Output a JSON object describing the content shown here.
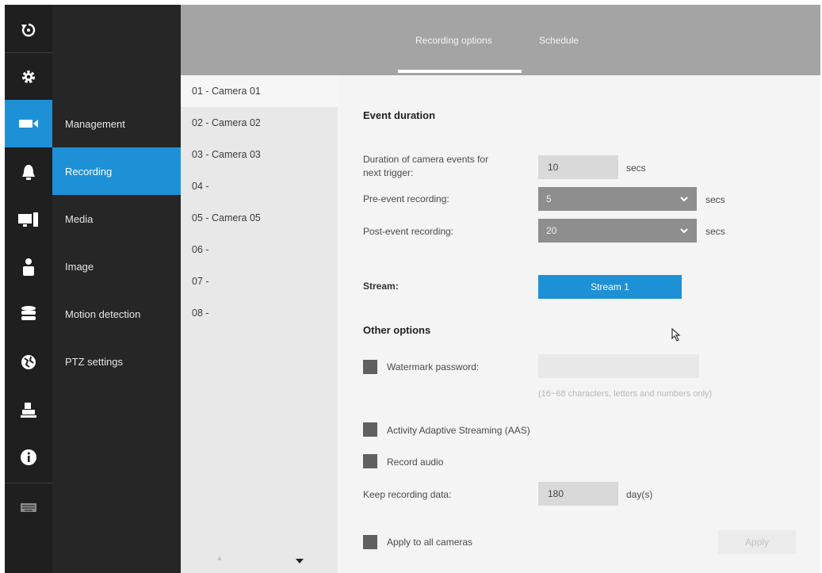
{
  "rail": {
    "icons": [
      "back-icon",
      "gear-icon",
      "camera-icon",
      "alarm-icon",
      "display-icon",
      "user-icon",
      "storage-icon",
      "network-icon",
      "pos-icon",
      "info-icon",
      "keyboard-icon"
    ],
    "active": "camera-icon"
  },
  "submenu": {
    "items": [
      "Management",
      "Recording",
      "Media",
      "Image",
      "Motion detection",
      "PTZ settings"
    ],
    "active": "Recording"
  },
  "header": {
    "tabs": [
      "Recording options",
      "Schedule"
    ],
    "active_tab": "Recording options"
  },
  "cameras": [
    "01 - Camera 01",
    "02 - Camera 02",
    "03 - Camera 03",
    "04 -",
    "05 - Camera 05",
    "06 -",
    "07 -",
    "08 -"
  ],
  "form": {
    "event_duration_title": "Event duration",
    "duration_label_line1": "Duration of camera events for",
    "duration_label_line2": "next trigger:",
    "duration_value": "10",
    "duration_unit": "secs",
    "pre_event_label": "Pre-event recording:",
    "pre_event_value": "5",
    "pre_event_unit": "secs",
    "post_event_label": "Post-event recording:",
    "post_event_value": "20",
    "post_event_unit": "secs",
    "stream_label": "Stream:",
    "stream_button": "Stream 1",
    "other_options_title": "Other options",
    "watermark_label": "Watermark password:",
    "watermark_value": "",
    "watermark_hint": "(16~68 characters, letters and numbers only)",
    "aas_label": "Activity Adaptive Streaming (AAS)",
    "record_audio_label": "Record audio",
    "keep_label": "Keep recording data:",
    "keep_value": "180",
    "keep_unit": "day(s)",
    "apply_all_label": "Apply to all cameras",
    "apply_button": "Apply"
  },
  "colors": {
    "accent": "#1e90d6",
    "rail_bg": "#1f1f1f",
    "submenu_bg": "#262626",
    "header_bg": "#a4a4a4"
  }
}
